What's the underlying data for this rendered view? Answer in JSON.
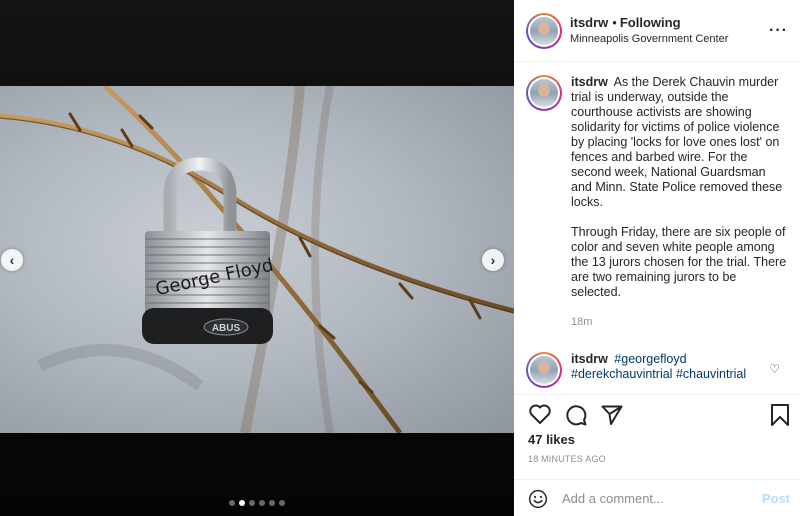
{
  "post": {
    "username": "itsdrw",
    "follow_status": "Following",
    "separator": "•",
    "location": "Minneapolis Government Center",
    "more_icon": "more-options-icon",
    "caption_paragraphs": [
      "As the Derek Chauvin murder trial is underway, outside the courthouse activists are showing solidarity for victims of police violence by placing 'locks for love ones lost' on fences and barbed wire. For the second week, National Guardsman and Minn. State Police removed these locks.",
      "Through Friday, there are six people of color and seven white people among the 13 jurors chosen for the trial. There are two remaining jurors to be selected."
    ],
    "caption_time": "18m",
    "lock_brand": "ABUS",
    "lock_writing": "George Floyd"
  },
  "comment": {
    "username": "itsdrw",
    "tags": [
      "#georgefloyd",
      "#derekchauvintrial",
      "#chauvintrial"
    ]
  },
  "carousel": {
    "prev_icon": "chevron-left-icon",
    "next_icon": "chevron-right-icon",
    "dot_count": 6,
    "active_index": 1
  },
  "actions": {
    "likes": "47 likes",
    "time_ago": "18 MINUTES AGO"
  },
  "composer": {
    "placeholder": "Add a comment...",
    "post_label": "Post"
  },
  "colors": {
    "link": "#00376b",
    "muted": "#8e8e8e",
    "post_button": "#b2dffc"
  }
}
